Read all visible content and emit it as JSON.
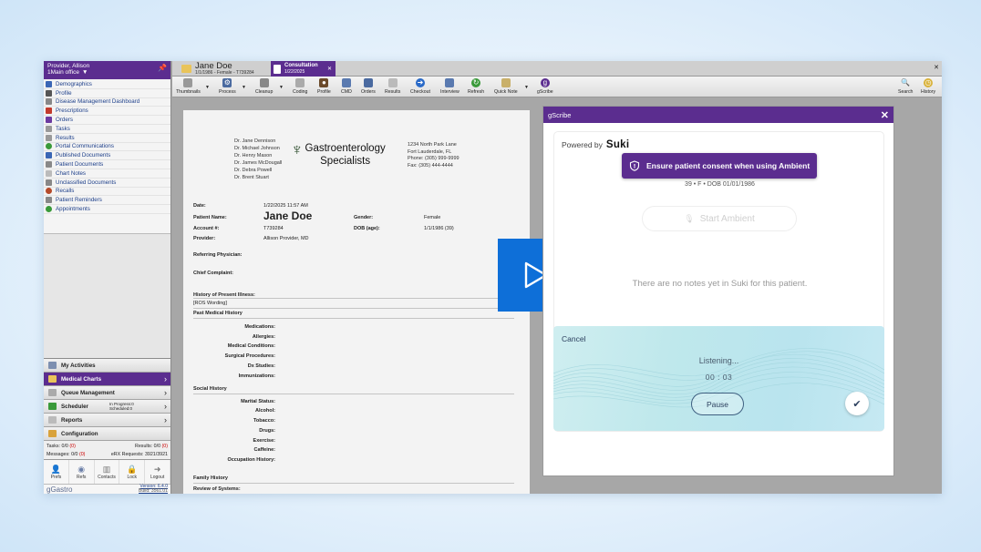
{
  "sidebar": {
    "provider_label": "Provider, Allison",
    "office_label": "1Main office",
    "items": [
      {
        "label": "Demographics",
        "icon": "people-icon",
        "color": "#3a66b5"
      },
      {
        "label": "Profile",
        "icon": "person-icon",
        "color": "#555"
      },
      {
        "label": "Disease Management Dashboard",
        "icon": "dashboard-icon",
        "color": "#888"
      },
      {
        "label": "Prescriptions",
        "icon": "rx-icon",
        "color": "#c23a2c"
      },
      {
        "label": "Orders",
        "icon": "orders-icon",
        "color": "#6b3aa0"
      },
      {
        "label": "Tasks",
        "icon": "tasks-icon",
        "color": "#999"
      },
      {
        "label": "Results",
        "icon": "results-icon",
        "color": "#999"
      },
      {
        "label": "Portal Communications",
        "icon": "globe-icon",
        "color": "#3a9a3a"
      },
      {
        "label": "Published Documents",
        "icon": "published-icon",
        "color": "#3a66b5"
      },
      {
        "label": "Patient Documents",
        "icon": "document-icon",
        "color": "#888"
      },
      {
        "label": "Chart Notes",
        "icon": "notes-icon",
        "color": "#bbb"
      },
      {
        "label": "Unclassified Documents",
        "icon": "unclassified-icon",
        "color": "#888"
      },
      {
        "label": "Recalls",
        "icon": "recall-icon",
        "color": "#b54a2a"
      },
      {
        "label": "Patient Reminders",
        "icon": "reminder-icon",
        "color": "#888"
      },
      {
        "label": "Appointments",
        "icon": "calendar-icon",
        "color": "#3a9a3a"
      }
    ],
    "nav": {
      "my_activities": "My Activities",
      "medical_charts": "Medical Charts",
      "queue_management": "Queue Management",
      "scheduler": "Scheduler",
      "scheduler_in_progress": "In Progress:0",
      "scheduler_scheduled": "Scheduled:0",
      "reports": "Reports",
      "configuration": "Configuration"
    },
    "stats": {
      "tasks_label": "Tasks:",
      "tasks_value": "0/0",
      "tasks_red": "(0)",
      "results_label": "Results:",
      "results_value": "0/0",
      "results_red": "(0)",
      "messages_label": "Messages:",
      "messages_value": "0/0",
      "messages_red": "(0)",
      "erx_label": "eRX Requests:",
      "erx_value": "3921/3921"
    },
    "tools": [
      "Prefs",
      "Refs",
      "Contacts",
      "Lock",
      "Logout"
    ],
    "brand": "gGastro",
    "version": "Version: 6.4.0",
    "build": "Build: 3561.01"
  },
  "tabs": {
    "patient_name": "Jane Doe",
    "patient_meta": "1/1/1986 - Female - T739284",
    "consult_title": "Consultation",
    "consult_date": "1/22/2025"
  },
  "toolbar": [
    "Thumbnails",
    "Process",
    "Cleanup",
    "Coding",
    "Profile",
    "CMD",
    "Orders",
    "Results",
    "Checkout",
    "Interview",
    "Refresh",
    "Quick Note",
    "gScribe",
    "Search",
    "History"
  ],
  "document": {
    "practitioners": [
      "Dr. Jane Dennison",
      "Dr. Michael Johnson",
      "Dr. Henry Mason",
      "Dr. James McDougall",
      "Dr. Debra Powell",
      "Dr. Brent Stuart"
    ],
    "logo_line1": "Gastroenterology",
    "logo_line2": "Specialists",
    "address": [
      "1234 North Park Lane",
      "Fort Lauderdale, FL",
      "Phone: (305) 999-9999",
      "Fax: (305) 444-4444"
    ],
    "date_label": "Date:",
    "date_value": "1/22/2025 11:57 AM",
    "patient_label": "Patient Name:",
    "patient_value": "Jane Doe",
    "gender_label": "Gender:",
    "gender_value": "Female",
    "account_label": "Account #:",
    "account_value": "T739284",
    "dob_label": "DOB (age):",
    "dob_value": "1/1/1986 (39)",
    "provider_label": "Provider:",
    "provider_value": "Allison Provider, MD",
    "referring_label": "Referring Physician:",
    "complaint_label": "Chief Complaint:",
    "hpi_label": "History of Present Illness:",
    "hpi_value": "[ROS Wording]",
    "pmh_label": "Past Medical History",
    "pmh_fields": [
      "Medications:",
      "Allergies:",
      "Medical Conditions:",
      "Surgical Procedures:",
      "Dx Studies:",
      "Immunizations:"
    ],
    "social_label": "Social History",
    "social_fields": [
      "Marital Status:",
      "Alcohol:",
      "Tobacco:",
      "Drugs:",
      "Exercise:",
      "Caffeine:",
      "Occupation History:"
    ],
    "family_label": "Family History",
    "ros_label": "Review of Systems:"
  },
  "gscribe": {
    "title": "gScribe",
    "powered_by": "Powered by",
    "powered_brand": "Suki",
    "consent": "Ensure patient consent when using Ambient",
    "patient_meta": "39 • F • DOB 01/01/1986",
    "start_ambient": "Start Ambient",
    "no_notes": "There are no notes yet in Suki for this patient.",
    "cancel": "Cancel",
    "listening": "Listening...",
    "timer": "00 : 03",
    "pause": "Pause"
  },
  "colors": {
    "brand_purple": "#5b2d8f",
    "play_blue": "#0e6fd8"
  }
}
